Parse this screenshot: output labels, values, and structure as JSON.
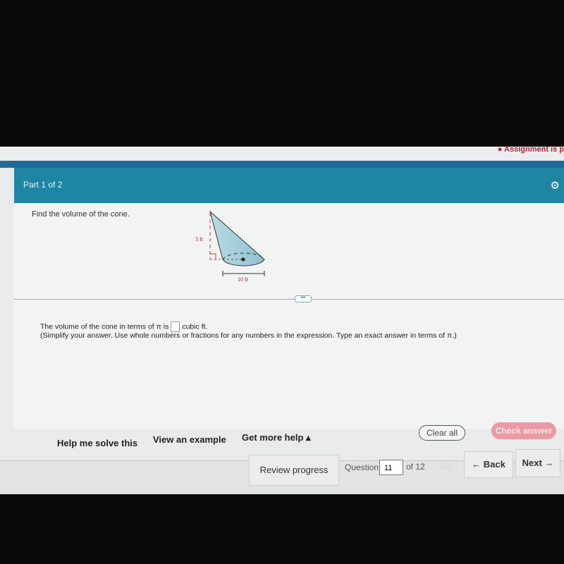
{
  "topbar": {
    "assignment_notice": "Assignment is p"
  },
  "header": {
    "part": "Part 1 of 2",
    "settings_icon": "gear-icon"
  },
  "question": {
    "prompt": "Find the volume of the cone.",
    "height_label": "3 ft",
    "diameter_label": "10 ft"
  },
  "answer": {
    "prefix": "The volume of the cone in terms of π is",
    "suffix": "cubic ft.",
    "value": "",
    "instructions": "(Simplify your answer. Use whole numbers or fractions for any numbers in the expression. Type an exact answer in terms of π.)"
  },
  "help": {
    "solve": "Help me solve this",
    "example": "View an example",
    "more": "Get more help ▴"
  },
  "actions": {
    "clear": "Clear all",
    "check": "Check answer"
  },
  "footer": {
    "review": "Review progress",
    "question_label": "Question",
    "question_number": "11",
    "of": "of 12",
    "go": "Go",
    "back": "← Back",
    "next": "Next →"
  },
  "colors": {
    "header": "#1e86a3",
    "check": "#e99aa5",
    "alert": "#b0243a"
  }
}
